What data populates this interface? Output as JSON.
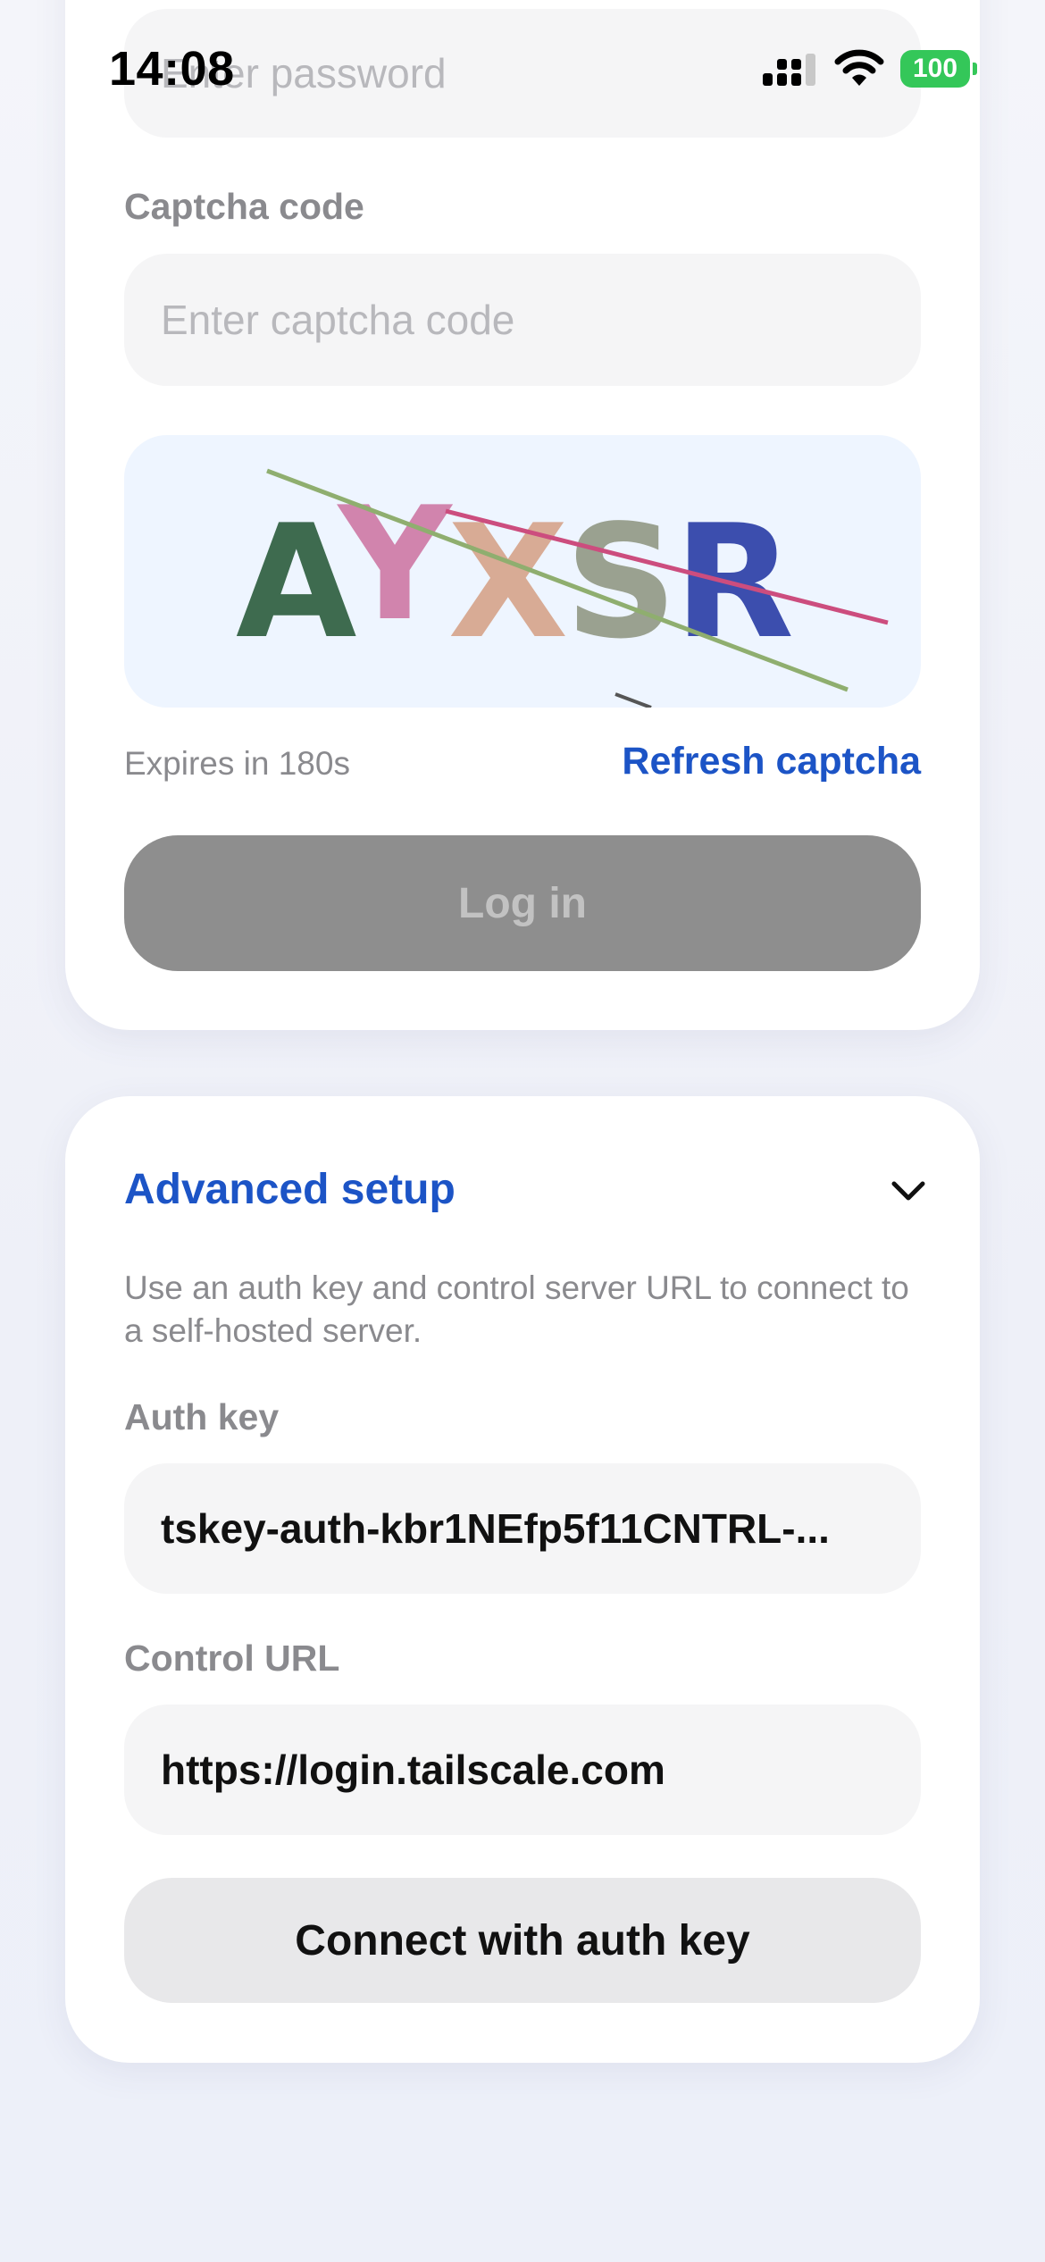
{
  "status_bar": {
    "time": "14:08",
    "battery": "100"
  },
  "login": {
    "password_placeholder": "Enter password",
    "captcha_label": "Captcha code",
    "captcha_placeholder": "Enter captcha code",
    "captcha_text": "AYXSR",
    "expires_text": "Expires in 180s",
    "refresh_label": "Refresh captcha",
    "login_button": "Log in"
  },
  "advanced": {
    "title": "Advanced setup",
    "description": "Use an auth key and control server URL to connect to a self-hosted server.",
    "auth_key_label": "Auth key",
    "auth_key_value": "tskey-auth-kbr1NEfp5f11CNTRL-...",
    "control_url_label": "Control URL",
    "control_url_value": "https://login.tailscale.com",
    "connect_button": "Connect with auth key"
  },
  "colors": {
    "accent": "#1c54c6",
    "battery": "#34c759",
    "login_button_bg": "#8e8e8e",
    "captcha_bg": "#eef5ff",
    "captcha_letters": [
      "#3e6b4f",
      "#d184ad",
      "#d8ab95",
      "#9aa190",
      "#3c4eae"
    ]
  },
  "icons": {
    "signal": "cellular-signal-icon",
    "wifi": "wifi-icon",
    "battery": "battery-icon",
    "chevron": "chevron-down-icon"
  }
}
